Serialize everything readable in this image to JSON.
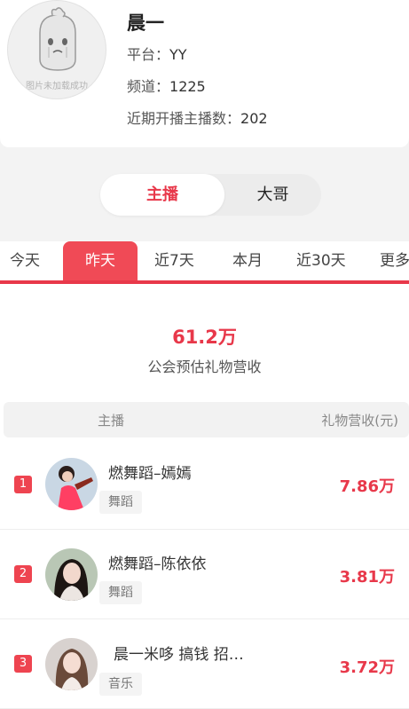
{
  "guild": {
    "avatar_placeholder": "图片未加载成功",
    "name": "晨一",
    "platform_label": "平台：",
    "platform_value": "YY",
    "channel_label": "频道：",
    "channel_value": "1225",
    "streamers_label": "近期开播主播数：",
    "streamers_value": "202"
  },
  "toggle": {
    "active": "主播",
    "inactive": "大哥"
  },
  "tabs": [
    {
      "label": "今天",
      "active": false
    },
    {
      "label": "昨天",
      "active": true
    },
    {
      "label": "近7天",
      "active": false
    },
    {
      "label": "本月",
      "active": false
    },
    {
      "label": "近30天",
      "active": false
    },
    {
      "label": "更多",
      "active": false
    }
  ],
  "summary": {
    "value": "61.2万",
    "label": "公会预估礼物营收"
  },
  "table": {
    "col_streamer": "主播",
    "col_revenue": "礼物营收(元)",
    "rows": [
      {
        "rank": "1",
        "name": "燃舞蹈–嫣嫣",
        "tag": "舞蹈",
        "amount": "7.86万"
      },
      {
        "rank": "2",
        "name": "燃舞蹈–陈依依",
        "tag": "舞蹈",
        "amount": "3.81万"
      },
      {
        "rank": "3",
        "name": "晨一米哆 搞钱 招…",
        "tag": "音乐",
        "amount": "3.72万"
      }
    ]
  },
  "colors": {
    "accent": "#e8384a",
    "tab_active_bg": "#f04a56"
  }
}
